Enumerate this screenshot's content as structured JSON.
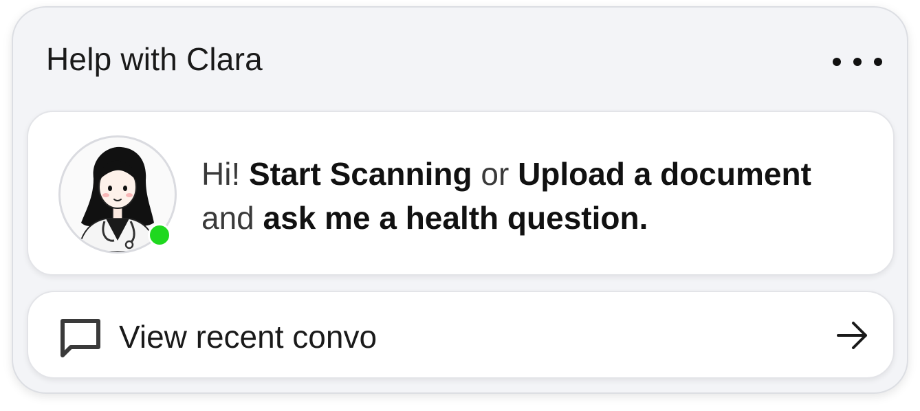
{
  "header": {
    "title": "Help with Clara",
    "more_icon": "more-horizontal-icon"
  },
  "assistant": {
    "name": "Clara",
    "avatar_icon": "doctor-avatar",
    "status_color": "#1fd81f",
    "message": {
      "part1": "Hi! ",
      "part2": "Start Scanning",
      "part3": " or ",
      "part4": "Upload a document",
      "part5": " and ",
      "part6": "ask me a health question."
    }
  },
  "recent": {
    "label": "View recent convo",
    "icon": "chat-bubble-icon",
    "arrow_icon": "arrow-right-icon"
  }
}
